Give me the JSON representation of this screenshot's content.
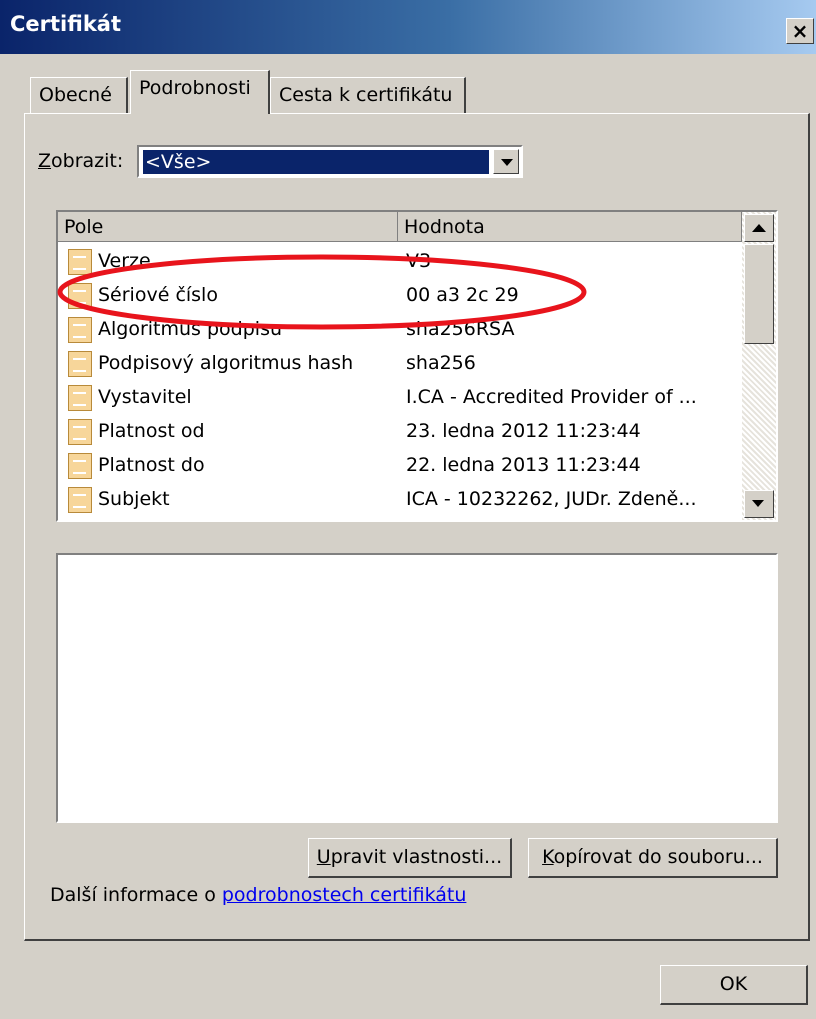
{
  "window": {
    "title": "Certifikát",
    "close_label": "×"
  },
  "tabs": [
    {
      "label": "Obecné"
    },
    {
      "label": "Podrobnosti"
    },
    {
      "label": "Cesta k certifikátu"
    }
  ],
  "filter": {
    "label_access_key": "Z",
    "label_rest": "obrazit:",
    "selected": "<Vše>"
  },
  "table": {
    "columns": [
      "Pole",
      "Hodnota"
    ],
    "rows": [
      {
        "field": "Verze",
        "value": "V3"
      },
      {
        "field": "Sériové číslo",
        "value": "00 a3 2c 29"
      },
      {
        "field": "Algoritmus podpisu",
        "value": "sha256RSA"
      },
      {
        "field": "Podpisový algoritmus hash",
        "value": "sha256"
      },
      {
        "field": "Vystavitel",
        "value": "I.CA - Accredited Provider of ..."
      },
      {
        "field": "Platnost od",
        "value": "23. ledna 2012 11:23:44"
      },
      {
        "field": "Platnost do",
        "value": "22. ledna 2013 11:23:44"
      },
      {
        "field": "Subjekt",
        "value": "ICA - 10232262, JUDr. Zdeně..."
      }
    ]
  },
  "buttons": {
    "edit_access_key": "U",
    "edit_rest": "pravit vlastnosti...",
    "copy_access_key": "K",
    "copy_rest": "opírovat do souboru...",
    "ok": "OK"
  },
  "info": {
    "prefix": "Další informace o ",
    "link": "podrobnostech certifikátu"
  },
  "annotation": {
    "color": "#e8141c"
  }
}
